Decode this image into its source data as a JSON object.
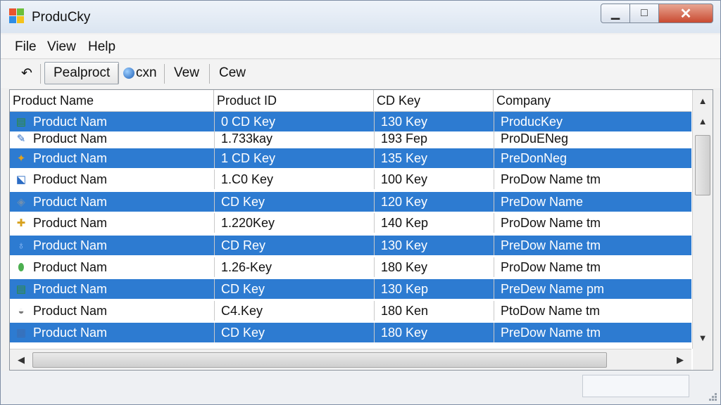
{
  "window": {
    "title": "ProduCky",
    "minimize": "▁",
    "maximize": "□",
    "close": "✕"
  },
  "menu": [
    "File",
    "View",
    "Help"
  ],
  "toolbar": {
    "back_icon": "↶",
    "btn1": "Pealproct",
    "btn2": "cxn",
    "btn3": "Vew",
    "btn4": "Cew"
  },
  "columns": [
    "Product Name",
    "Product ID",
    "CD Key",
    "Company"
  ],
  "rows": [
    {
      "icon": "▤",
      "icon_color": "#2e8b3a",
      "name": "Product Nam",
      "id": "0 CD Key",
      "key": "130 Key",
      "company": "ProducKey",
      "selected": true
    },
    {
      "icon": "✎",
      "icon_color": "#2b6cc4",
      "name": "Product Nam",
      "id": "1.733kay",
      "key": "193 Fep",
      "company": "ProDuENeg",
      "selected": false
    },
    {
      "icon": "✦",
      "icon_color": "#e4a21a",
      "name": "Product Nam",
      "id": "1 CD Key",
      "key": "135 Key",
      "company": "PreDonNeg",
      "selected": true
    },
    {
      "icon": "⬕",
      "icon_color": "#2b6cc4",
      "name": "Product Nam",
      "id": "1.C0 Key",
      "key": "100 Key",
      "company": "ProDow Name tm",
      "selected": false
    },
    {
      "icon": "◈",
      "icon_color": "#6f8fb0",
      "name": "Product Nam",
      "id": "CD Key",
      "key": "120 Key",
      "company": "PreDow Name",
      "selected": true
    },
    {
      "icon": "✚",
      "icon_color": "#d8a21e",
      "name": "Product Nam",
      "id": "1.220Key",
      "key": "140 Kep",
      "company": "ProDow Name tm",
      "selected": false
    },
    {
      "icon": "♁",
      "icon_color": "#9fc7ff",
      "name": "Product Nam",
      "id": "CD Rey",
      "key": "130 Key",
      "company": "PreDow Name tm",
      "selected": true
    },
    {
      "icon": "⬮",
      "icon_color": "#4caf50",
      "name": "Product Nam",
      "id": "1.26-Key",
      "key": "180 Key",
      "company": "ProDow Name tm",
      "selected": false
    },
    {
      "icon": "▤",
      "icon_color": "#2e8b3a",
      "name": "Product Nam",
      "id": "CD Key",
      "key": "130 Kep",
      "company": "PreDew Name pm",
      "selected": true
    },
    {
      "icon": "◒",
      "icon_color": "#777777",
      "name": "Product Nam",
      "id": "C4.Key",
      "key": "180 Ken",
      "company": "PtoDow Name tm",
      "selected": false
    },
    {
      "icon": "▦",
      "icon_color": "#3b6db3",
      "name": "Product Nam",
      "id": "CD Key",
      "key": "180 Key",
      "company": "PreDow Name tm",
      "selected": true
    }
  ],
  "colors": {
    "selection": "#2d7bd1"
  }
}
